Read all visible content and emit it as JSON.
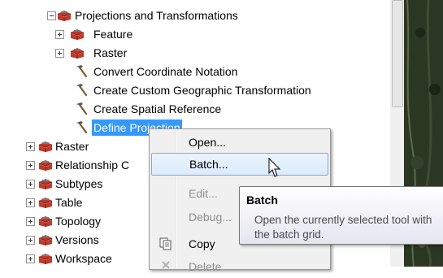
{
  "tree": {
    "items": [
      {
        "label": "Projections and Transformations",
        "type": "toolset",
        "expander": "minus"
      },
      {
        "label": "Feature",
        "type": "toolset",
        "expander": "plus"
      },
      {
        "label": "Raster",
        "type": "toolset",
        "expander": "plus"
      },
      {
        "label": "Convert Coordinate Notation",
        "type": "tool"
      },
      {
        "label": "Create Custom Geographic Transformation",
        "type": "tool"
      },
      {
        "label": "Create Spatial Reference",
        "type": "tool"
      },
      {
        "label": "Define Projection",
        "type": "tool",
        "selected": true
      },
      {
        "label": "Raster",
        "type": "toolset",
        "expander": "plus"
      },
      {
        "label": "Relationship C",
        "type": "toolset",
        "expander": "plus"
      },
      {
        "label": "Subtypes",
        "type": "toolset",
        "expander": "plus"
      },
      {
        "label": "Table",
        "type": "toolset",
        "expander": "plus"
      },
      {
        "label": "Topology",
        "type": "toolset",
        "expander": "plus"
      },
      {
        "label": "Versions",
        "type": "toolset",
        "expander": "plus"
      },
      {
        "label": "Workspace",
        "type": "toolset",
        "expander": "plus"
      }
    ]
  },
  "context_menu": {
    "items": [
      {
        "label": "Open...",
        "enabled": true
      },
      {
        "label": "Batch...",
        "enabled": true,
        "highlighted": true
      },
      {
        "label": "Edit...",
        "enabled": false
      },
      {
        "label": "Debug...",
        "enabled": false
      },
      {
        "label": "Copy",
        "enabled": true,
        "icon": "copy-icon"
      },
      {
        "label": "Delete",
        "enabled": false,
        "icon": "delete-icon"
      }
    ]
  },
  "tooltip": {
    "title": "Batch",
    "description": "Open the currently selected tool with the batch grid."
  },
  "colors": {
    "selection": "#3399ff",
    "menu_background": "#f0f0f0",
    "menu_highlight_border": "#86a7d2",
    "toolbox_red": "#b5352f",
    "map_background": "#26331f"
  }
}
